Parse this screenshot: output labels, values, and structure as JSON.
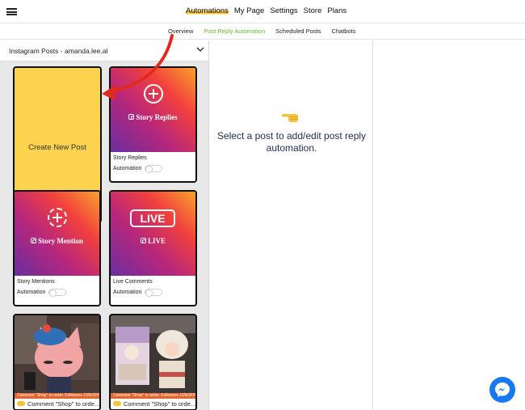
{
  "topnav": {
    "items": [
      {
        "label": "Automations",
        "active": true
      },
      {
        "label": "My Page"
      },
      {
        "label": "Settings"
      },
      {
        "label": "Store"
      },
      {
        "label": "Plans"
      }
    ]
  },
  "subnav": {
    "items": [
      {
        "label": "Overview"
      },
      {
        "label": "Post Reply Automation",
        "active": true
      },
      {
        "label": "Scheduled Posts"
      },
      {
        "label": "Chatbots"
      }
    ]
  },
  "account": {
    "label": "Instagram Posts - amanda.lee.al"
  },
  "cards": {
    "create_label": "Create New Post",
    "story_replies": {
      "graphic": "Story Replies",
      "title": "Story Replies",
      "automation_label": "Automation"
    },
    "story_mention": {
      "graphic": "Story Mention",
      "title": "Story Mentions",
      "automation_label": "Automation"
    },
    "live": {
      "badge": "LIVE",
      "graphic": "LIVE",
      "title": "Live Comments",
      "automation_label": "Automation"
    },
    "post1": {
      "banner": "Comment \"Shop\" to order. Followers 10%OFF",
      "caption": "Comment \"Shop\" to orde..."
    },
    "post2": {
      "banner": "Comment \"Shop\" to order. Followers 10%OFF",
      "caption": "Comment \"Shop\" to orde..."
    }
  },
  "main": {
    "message": "Select a post to add/edit post reply automation."
  },
  "colors": {
    "accent_yellow": "#fbd34e",
    "active_green": "#67b832",
    "messenger_blue": "#1778f2"
  }
}
